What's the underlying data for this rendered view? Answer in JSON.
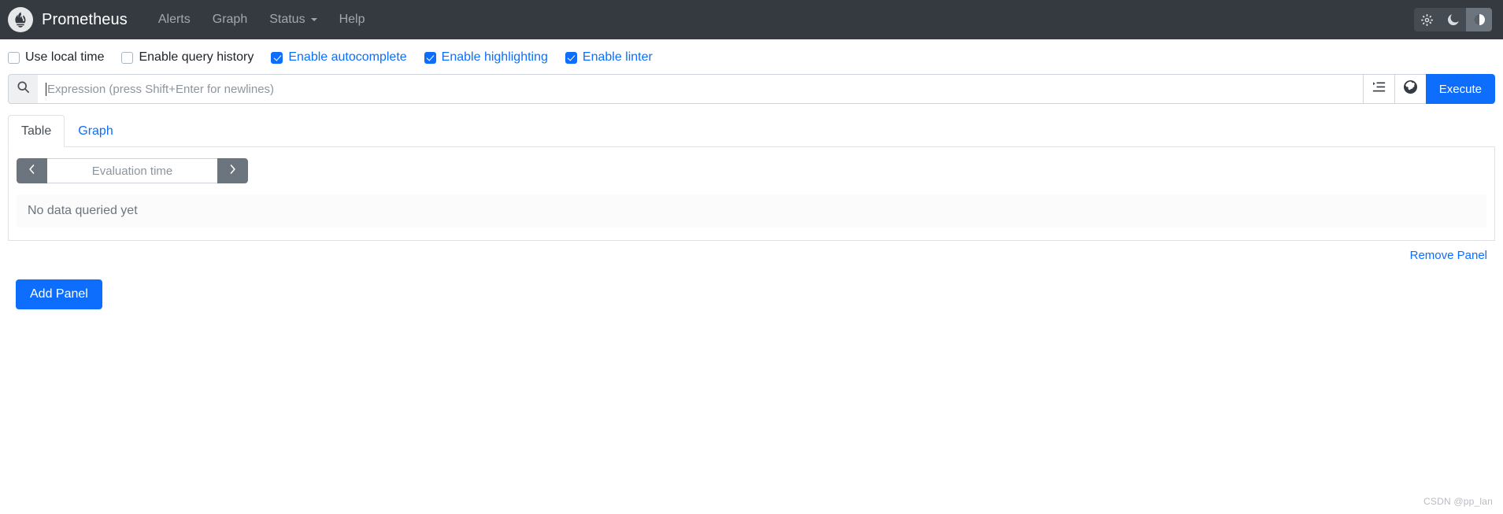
{
  "navbar": {
    "logo_icon": "prometheus-torch-logo",
    "brand": "Prometheus",
    "links": [
      {
        "label": "Alerts",
        "has_caret": false
      },
      {
        "label": "Graph",
        "has_caret": false
      },
      {
        "label": "Status",
        "has_caret": true
      },
      {
        "label": "Help",
        "has_caret": false
      }
    ],
    "theme_buttons": [
      {
        "name": "light-theme",
        "icon": "sun-icon",
        "active": false
      },
      {
        "name": "dark-theme",
        "icon": "moon-icon",
        "active": false
      },
      {
        "name": "auto-theme",
        "icon": "half-circle-icon",
        "active": true
      }
    ],
    "colors": {
      "background": "#343a40",
      "brand_text": "#ffffff",
      "link_text": "#8f959b"
    }
  },
  "options": [
    {
      "label": "Use local time",
      "checked": false
    },
    {
      "label": "Enable query history",
      "checked": false
    },
    {
      "label": "Enable autocomplete",
      "checked": true
    },
    {
      "label": "Enable highlighting",
      "checked": true
    },
    {
      "label": "Enable linter",
      "checked": true
    }
  ],
  "expression": {
    "search_icon": "search-icon",
    "value": "",
    "placeholder": "Expression (press Shift+Enter for newlines)",
    "metrics_explorer_icon": "metrics-explorer-icon",
    "history_icon": "globe-history-icon",
    "execute_label": "Execute"
  },
  "panel": {
    "tabs": [
      {
        "label": "Table",
        "active": true
      },
      {
        "label": "Graph",
        "active": false
      }
    ],
    "eval_time": {
      "prev_icon": "chevron-left-icon",
      "next_icon": "chevron-right-icon",
      "value": "",
      "placeholder": "Evaluation time"
    },
    "empty_state": "No data queried yet",
    "remove_panel_label": "Remove Panel"
  },
  "actions": {
    "add_panel_label": "Add Panel"
  },
  "watermark": "CSDN @pp_lan",
  "colors": {
    "accent": "#0d6efd",
    "navbar": "#343a40",
    "muted": "#6c757d",
    "border": "#dee2e6"
  }
}
